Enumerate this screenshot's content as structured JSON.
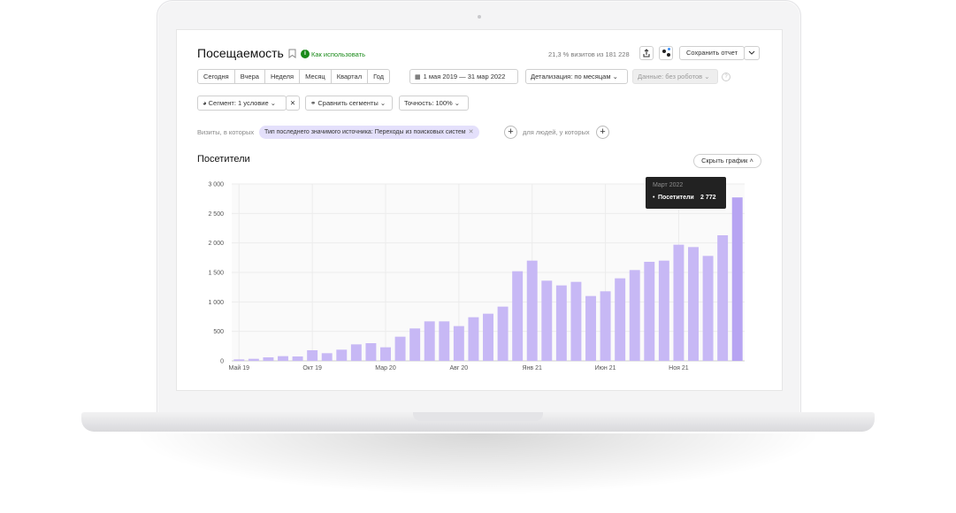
{
  "header": {
    "title": "Посещаемость",
    "help_link": "Как использовать",
    "visits_info": "21,3 % визитов из 181 228",
    "save_label": "Сохранить отчет"
  },
  "periods": [
    "Сегодня",
    "Вчера",
    "Неделя",
    "Месяц",
    "Квартал",
    "Год"
  ],
  "date_range": "1 мая 2019 — 31 мар 2022",
  "detail": "Детализация: по месяцам",
  "data_filter": "Данные: без роботов",
  "segment": "Сегмент: 1 условие",
  "compare": "Сравнить сегменты",
  "accuracy": "Точность: 100%",
  "filter": {
    "prefix": "Визиты, в которых",
    "tag": "Тип последнего значимого источника: Переходы из поисковых систем",
    "people": "для людей, у которых"
  },
  "chart_section": {
    "title": "Посетители",
    "hide_label": "Скрыть график"
  },
  "tooltip": {
    "date": "Март 2022",
    "series": "Посетители",
    "value": "2 772"
  },
  "colors": {
    "bar": "#c7b8f5",
    "bar_last": "#b7a4f2",
    "accent_green": "#1a8a1a"
  },
  "chart_data": {
    "type": "bar",
    "series": [
      {
        "name": "Посетители",
        "values": [
          25,
          35,
          60,
          80,
          75,
          180,
          130,
          190,
          280,
          300,
          230,
          410,
          550,
          670,
          670,
          590,
          740,
          800,
          920,
          1520,
          1700,
          1360,
          1280,
          1340,
          1100,
          1180,
          1400,
          1540,
          1680,
          1700,
          1970,
          1930,
          1780,
          2130,
          2772
        ]
      }
    ],
    "x_tick_labels": [
      {
        "index": 0,
        "label": "Май 19"
      },
      {
        "index": 5,
        "label": "Окт 19"
      },
      {
        "index": 10,
        "label": "Мар 20"
      },
      {
        "index": 15,
        "label": "Авг 20"
      },
      {
        "index": 20,
        "label": "Янв 21"
      },
      {
        "index": 25,
        "label": "Июн 21"
      },
      {
        "index": 30,
        "label": "Ноя 21"
      }
    ],
    "y_ticks": [
      0,
      500,
      1000,
      1500,
      2000,
      2500,
      3000
    ],
    "y_tick_labels": [
      "0",
      "500",
      "1 000",
      "1 500",
      "2 000",
      "2 500",
      "3 000"
    ],
    "ylim": [
      0,
      3000
    ],
    "grid": true
  }
}
